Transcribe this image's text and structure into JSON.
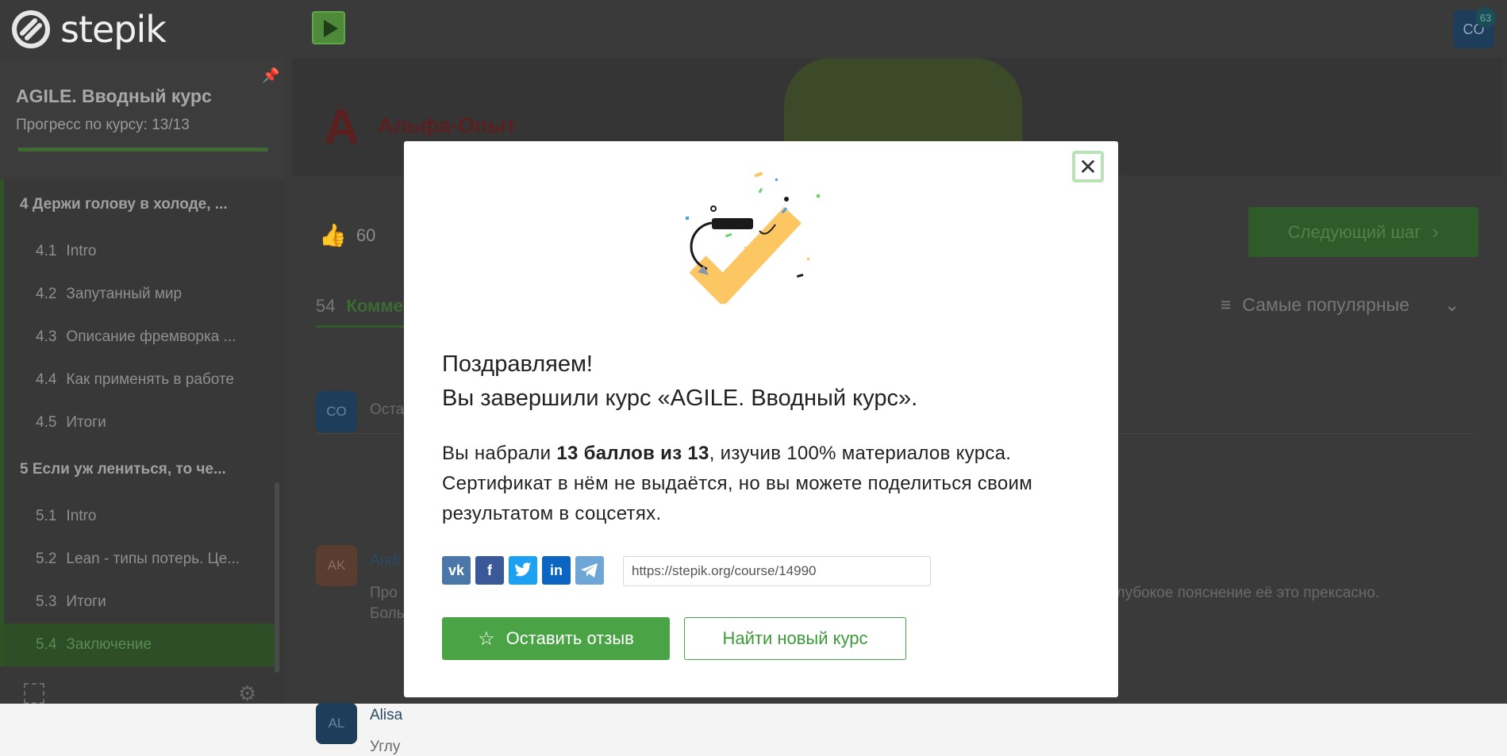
{
  "topbar": {
    "logo_text": "stepik",
    "avatar_initials": "CO",
    "avatar_badge": "63"
  },
  "sidebar": {
    "course_title": "AGILE. Вводный курс",
    "progress_label": "Прогресс по курсу:",
    "progress_value": "13/13",
    "progress_fraction": 1.0,
    "sections": [
      {
        "title": "4  Держи голову в холоде, ...",
        "lessons": [
          {
            "num": "4.1",
            "title": "Intro"
          },
          {
            "num": "4.2",
            "title": "Запутанный мир"
          },
          {
            "num": "4.3",
            "title": "Описание фремворка ..."
          },
          {
            "num": "4.4",
            "title": "Как применять в работе"
          },
          {
            "num": "4.5",
            "title": "Итоги"
          }
        ]
      },
      {
        "title": "5  Если уж лениться, то че...",
        "lessons": [
          {
            "num": "5.1",
            "title": "Intro"
          },
          {
            "num": "5.2",
            "title": "Lean - типы потерь. Це..."
          },
          {
            "num": "5.3",
            "title": "Итоги"
          },
          {
            "num": "5.4",
            "title": "Заключение"
          }
        ]
      }
    ]
  },
  "main": {
    "banner_text": "Альфа-Опыт",
    "likes": "60",
    "next_step": "Следующий шаг",
    "comments_count": "54",
    "comments_tab": "Комме",
    "sort_label": "Самые популярные",
    "comment_placeholder": "Оста",
    "commenter1_initials": "CO",
    "commenter2_initials": "AK",
    "commenter2_name": "Andr",
    "commenter2_text1": "Про",
    "commenter2_text1_tail": "глубокое пояснение её это прексасно.",
    "commenter2_text2": "Боль",
    "commenter3_initials": "AL",
    "commenter3_name": "Alisa",
    "commenter3_text": "Углу"
  },
  "modal": {
    "heading_line1": "Поздравляем!",
    "heading_line2": "Вы завершили курс «AGILE. Вводный курс».",
    "text_pre": "Вы набрали ",
    "text_bold": "13 баллов из 13",
    "text_post": ", изучив 100% материалов курса.",
    "text_line2": "Сертификат в нём не выдаётся, но вы можете поделиться своим",
    "text_line3": "результатом в соцсетях.",
    "share_url": "https://stepik.org/course/14990",
    "btn_review": "Оставить отзыв",
    "btn_find": "Найти новый курс",
    "social_icons": [
      "vk-icon",
      "facebook-icon",
      "twitter-icon",
      "linkedin-icon",
      "telegram-icon"
    ]
  }
}
